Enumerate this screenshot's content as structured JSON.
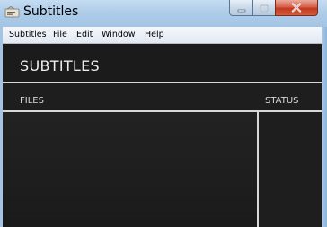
{
  "window": {
    "title": "Subtitles",
    "controls": {
      "minimize_icon": "minimize-icon",
      "maximize_icon": "maximize-icon",
      "close_icon": "close-icon"
    }
  },
  "menubar": {
    "items": [
      {
        "label": "Subtitles"
      },
      {
        "label": "File"
      },
      {
        "label": "Edit"
      },
      {
        "label": "Window"
      },
      {
        "label": "Help"
      }
    ]
  },
  "main": {
    "title": "SUBTITLES",
    "columns": {
      "files": "FILES",
      "status": "STATUS"
    },
    "files": []
  },
  "colors": {
    "background": "#1c1c1c",
    "text": "#d8d8d8",
    "title_text": "#ececec",
    "rule": "#d8d8d8",
    "titlebar": "#afcde9",
    "close_button": "#c3391f"
  }
}
